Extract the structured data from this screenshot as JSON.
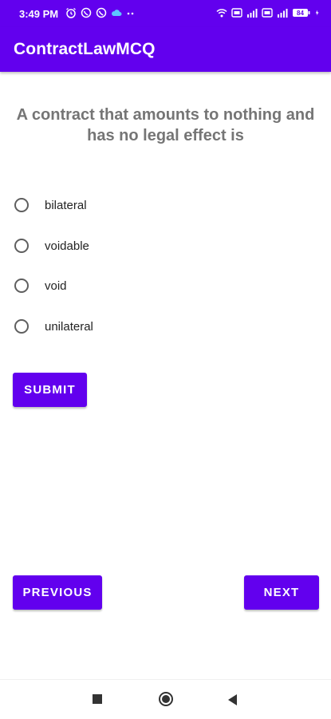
{
  "status_bar": {
    "time": "3:49 PM",
    "left_icons": [
      "alarm-icon",
      "whatsapp-icon",
      "whatsapp-icon",
      "cloud-icon",
      "more-dots-icon"
    ],
    "right_icons": [
      "wifi-icon",
      "volte-icon",
      "signal-icon",
      "volte-icon",
      "signal-icon",
      "battery-icon",
      "charging-icon"
    ],
    "battery": "84"
  },
  "app_bar": {
    "title": "ContractLawMCQ"
  },
  "question": {
    "text": "A contract that amounts to nothing and has no legal effect is"
  },
  "options": [
    {
      "label": "bilateral",
      "selected": false
    },
    {
      "label": "voidable",
      "selected": false
    },
    {
      "label": "void",
      "selected": false
    },
    {
      "label": "unilateral",
      "selected": false
    }
  ],
  "buttons": {
    "submit": "SUBMIT",
    "previous": "PREVIOUS",
    "next": "NEXT"
  },
  "nav_bar": {
    "icons": [
      "recents-icon",
      "home-icon",
      "back-icon"
    ]
  },
  "colors": {
    "primary": "#6200EE",
    "question_text": "#757575"
  }
}
